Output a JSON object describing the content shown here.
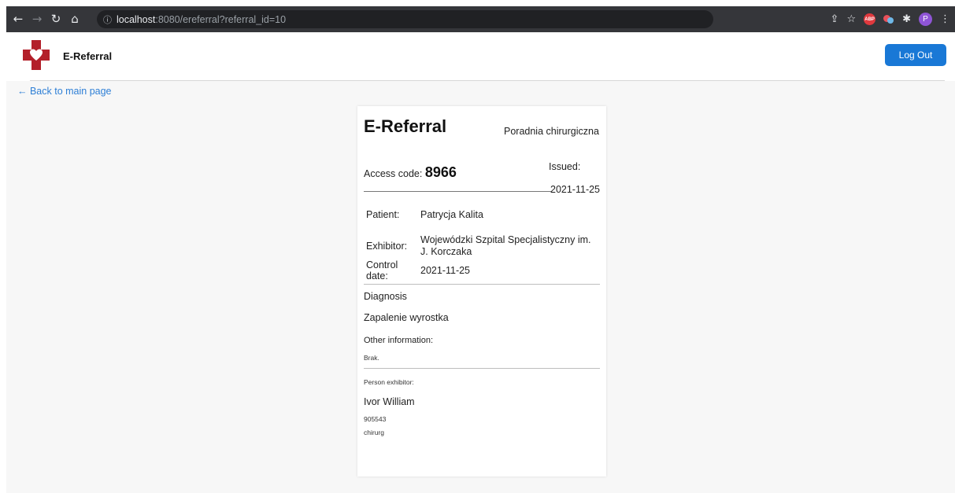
{
  "browser": {
    "url_host": "localhost",
    "url_path": ":8080/ereferral?referral_id=10",
    "profile_initial": "P",
    "abp_label": "ABP"
  },
  "header": {
    "brand": "E-Referral",
    "logout_label": "Log Out"
  },
  "nav": {
    "back_link": "← Back to main page"
  },
  "referral": {
    "title": "E-Referral",
    "clinic": "Poradnia chirurgiczna",
    "access_code_label": "Access code:",
    "access_code": "8966",
    "issued_label": "Issued:",
    "issued_date": "2021-11-25",
    "patient_label": "Patient:",
    "patient": "Patrycja Kalita",
    "exhibitor_label": "Exhibitor:",
    "exhibitor_line1": "Wojewódzki Szpital Specjalistyczny im.",
    "exhibitor_line2": "J. Korczaka",
    "control_label_line1": "Control",
    "control_label_line2": "date:",
    "control_date": "2021-11-25",
    "diagnosis_label": "Diagnosis",
    "diagnosis": "Zapalenie wyrostka",
    "other_info_label": "Other information:",
    "other_info": "Brak.",
    "person_exhibitor_label": "Person exhibitor:",
    "person_name": "Ivor William",
    "person_number": "905543",
    "person_role": "chirurg"
  },
  "colors": {
    "accent": "#1978d6",
    "logo_red": "#b3202a",
    "link": "#2e7fd6"
  }
}
